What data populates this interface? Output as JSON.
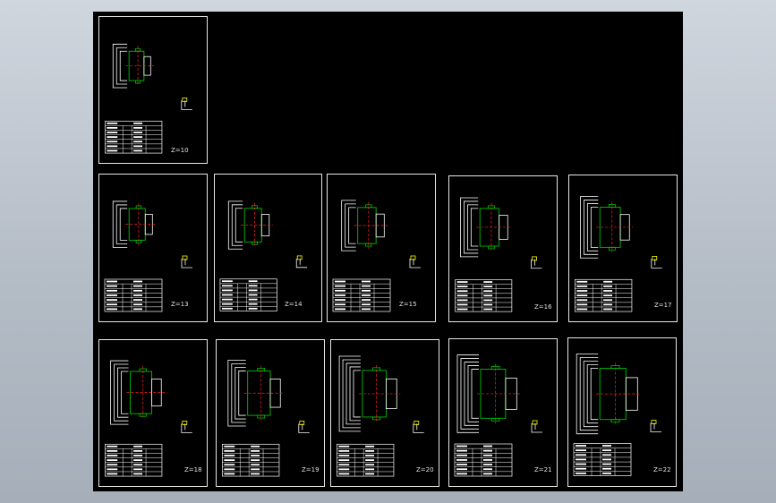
{
  "drawing": {
    "sheets": [
      {
        "label": "Z=10"
      },
      {
        "label": "Z=13"
      },
      {
        "label": "Z=14"
      },
      {
        "label": "Z=15"
      },
      {
        "label": "Z=16"
      },
      {
        "label": "Z=17"
      },
      {
        "label": "Z=18"
      },
      {
        "label": "Z=19"
      },
      {
        "label": "Z=20"
      },
      {
        "label": "Z=21"
      },
      {
        "label": "Z=22"
      }
    ],
    "colors": {
      "background": "#000000",
      "border": "#e8e8e8",
      "outline": "#ffffff",
      "gear_profile": "#00c000",
      "centerline": "#ff2020",
      "symbol": "#ffff00",
      "app_backdrop": "#b8c0ca"
    }
  }
}
